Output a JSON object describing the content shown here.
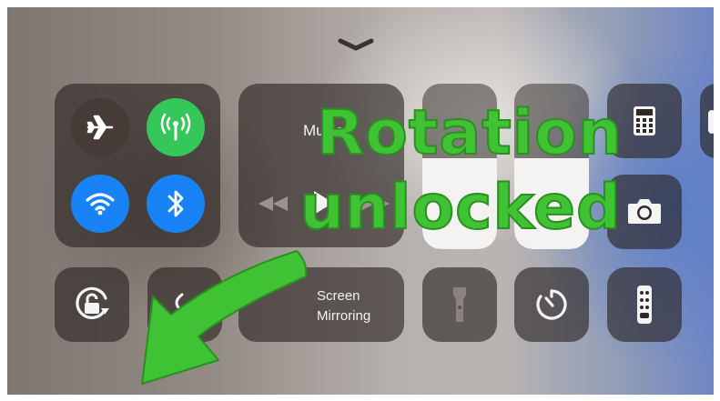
{
  "headline": {
    "line1": "Rotation",
    "line2": "unlocked",
    "color": "#3fc233"
  },
  "control_center": {
    "dismiss_icon": "chevron-down-icon",
    "connectivity": {
      "airplane": {
        "icon": "airplane-icon",
        "state": "off"
      },
      "cellular": {
        "icon": "cellular-antenna-icon",
        "state": "on",
        "color": "#35c759"
      },
      "wifi": {
        "icon": "wifi-icon",
        "state": "on",
        "color": "#1a82f7"
      },
      "bluetooth": {
        "icon": "bluetooth-icon",
        "state": "on",
        "color": "#1a82f7"
      }
    },
    "music": {
      "title": "Music",
      "controls": [
        "previous-icon",
        "play-icon",
        "next-icon"
      ]
    },
    "screen_mirroring": {
      "line1": "Screen",
      "line2": "Mirroring"
    },
    "shortcuts": [
      "rotation-lock-icon",
      "flashlight-icon",
      "timer-icon",
      "calculator-icon",
      "camera-icon",
      "apple-tv-remote-icon"
    ]
  },
  "arrow_color": "#3fc233"
}
